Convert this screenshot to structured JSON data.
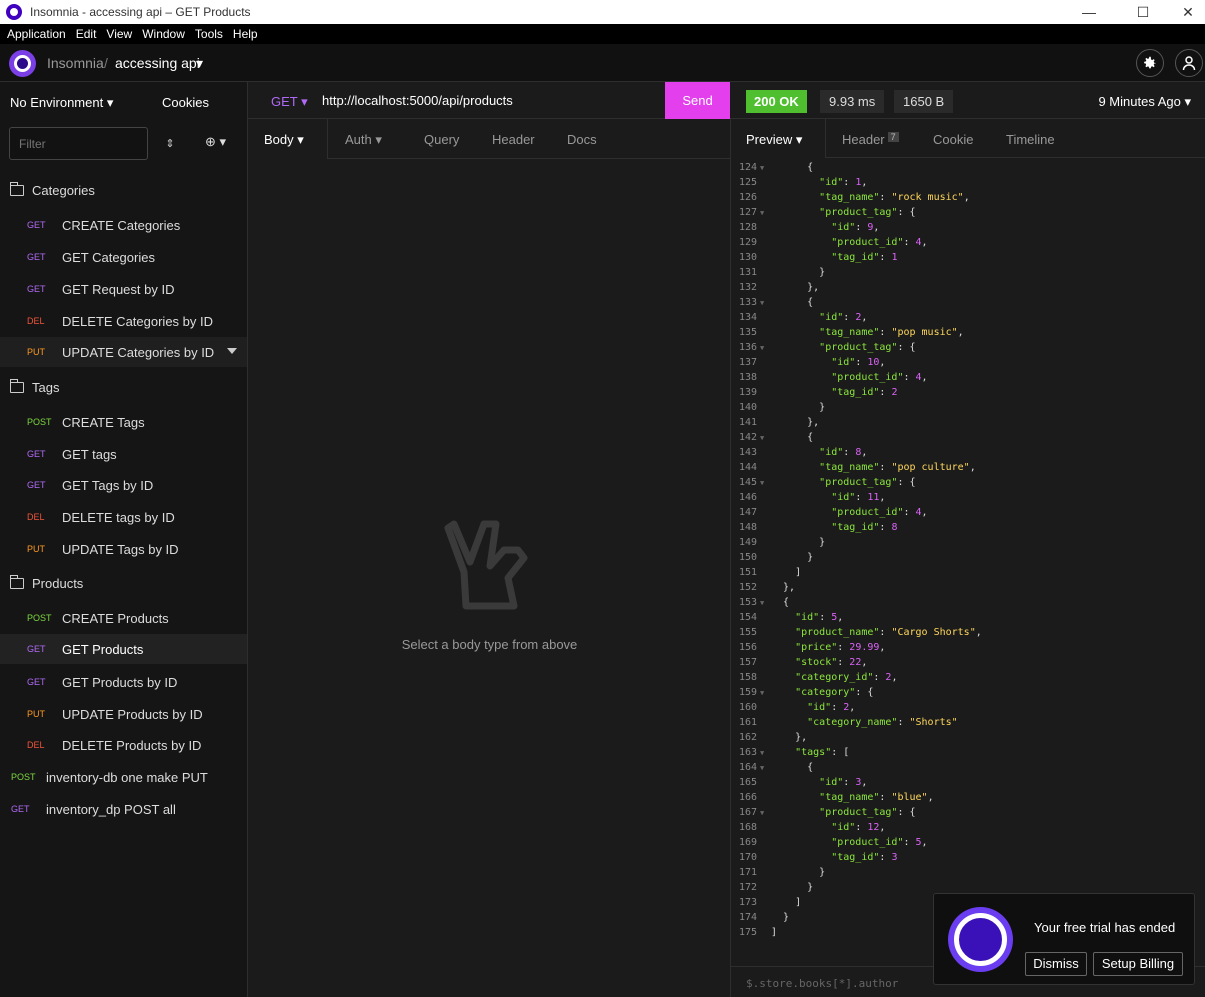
{
  "window": {
    "title": "Insomnia - accessing api – GET Products",
    "min": "—",
    "max": "☐",
    "close": "✕"
  },
  "menu": [
    "Application",
    "Edit",
    "View",
    "Window",
    "Tools",
    "Help"
  ],
  "header": {
    "app": "Insomnia",
    "sep": "/",
    "project": "accessing api",
    "caret": "▾"
  },
  "sidebar": {
    "environment": "No Environment ▾",
    "cookies": "Cookies",
    "filter_placeholder": "Filter",
    "sort_icon": "⇕",
    "add_icon": "⊕ ▾",
    "folders": [
      {
        "label": "Categories",
        "items": [
          {
            "method": "GET",
            "name": "CREATE Categories"
          },
          {
            "method": "GET",
            "name": "GET Categories"
          },
          {
            "method": "GET",
            "name": "GET Request by ID"
          },
          {
            "method": "DEL",
            "name": "DELETE Categories by ID"
          },
          {
            "method": "PUT",
            "name": "UPDATE Categories by ID"
          }
        ]
      },
      {
        "label": "Tags",
        "items": [
          {
            "method": "POST",
            "name": "CREATE Tags"
          },
          {
            "method": "GET",
            "name": "GET tags"
          },
          {
            "method": "GET",
            "name": "GET Tags by ID"
          },
          {
            "method": "DEL",
            "name": "DELETE tags by ID"
          },
          {
            "method": "PUT",
            "name": "UPDATE Tags by ID"
          }
        ]
      },
      {
        "label": "Products",
        "items": [
          {
            "method": "POST",
            "name": "CREATE Products"
          },
          {
            "method": "GET",
            "name": "GET Products"
          },
          {
            "method": "GET",
            "name": "GET Products by ID"
          },
          {
            "method": "PUT",
            "name": "UPDATE Products by ID"
          },
          {
            "method": "DEL",
            "name": "DELETE Products by ID"
          }
        ]
      }
    ],
    "root_items": [
      {
        "method": "POST",
        "name": "inventory-db one make PUT"
      },
      {
        "method": "GET",
        "name": "inventory_dp POST all"
      }
    ]
  },
  "request": {
    "method": "GET ▾",
    "url": "http://localhost:5000/api/products",
    "send": "Send",
    "tabs": [
      "Body ▾",
      "Auth ▾",
      "Query",
      "Header",
      "Docs"
    ],
    "empty_text": "Select a body type from above"
  },
  "response": {
    "status": "200 OK",
    "time": "9.93 ms",
    "size": "1650 B",
    "ago": "9 Minutes Ago ▾",
    "tabs": [
      "Preview ▾",
      "Header",
      "Cookie",
      "Timeline"
    ],
    "header_count": "7",
    "filter_placeholder": "$.store.books[*].author",
    "code": [
      {
        "n": "124",
        "f": true,
        "t": "      {"
      },
      {
        "n": "125",
        "t": "        \"id\": 1,"
      },
      {
        "n": "126",
        "t": "        \"tag_name\": \"rock music\","
      },
      {
        "n": "127",
        "f": true,
        "t": "        \"product_tag\": {"
      },
      {
        "n": "128",
        "t": "          \"id\": 9,"
      },
      {
        "n": "129",
        "t": "          \"product_id\": 4,"
      },
      {
        "n": "130",
        "t": "          \"tag_id\": 1"
      },
      {
        "n": "131",
        "t": "        }"
      },
      {
        "n": "132",
        "t": "      },"
      },
      {
        "n": "133",
        "f": true,
        "t": "      {"
      },
      {
        "n": "134",
        "t": "        \"id\": 2,"
      },
      {
        "n": "135",
        "t": "        \"tag_name\": \"pop music\","
      },
      {
        "n": "136",
        "f": true,
        "t": "        \"product_tag\": {"
      },
      {
        "n": "137",
        "t": "          \"id\": 10,"
      },
      {
        "n": "138",
        "t": "          \"product_id\": 4,"
      },
      {
        "n": "139",
        "t": "          \"tag_id\": 2"
      },
      {
        "n": "140",
        "t": "        }"
      },
      {
        "n": "141",
        "t": "      },"
      },
      {
        "n": "142",
        "f": true,
        "t": "      {"
      },
      {
        "n": "143",
        "t": "        \"id\": 8,"
      },
      {
        "n": "144",
        "t": "        \"tag_name\": \"pop culture\","
      },
      {
        "n": "145",
        "f": true,
        "t": "        \"product_tag\": {"
      },
      {
        "n": "146",
        "t": "          \"id\": 11,"
      },
      {
        "n": "147",
        "t": "          \"product_id\": 4,"
      },
      {
        "n": "148",
        "t": "          \"tag_id\": 8"
      },
      {
        "n": "149",
        "t": "        }"
      },
      {
        "n": "150",
        "t": "      }"
      },
      {
        "n": "151",
        "t": "    ]"
      },
      {
        "n": "152",
        "t": "  },"
      },
      {
        "n": "153",
        "f": true,
        "t": "  {"
      },
      {
        "n": "154",
        "t": "    \"id\": 5,"
      },
      {
        "n": "155",
        "t": "    \"product_name\": \"Cargo Shorts\","
      },
      {
        "n": "156",
        "t": "    \"price\": 29.99,"
      },
      {
        "n": "157",
        "t": "    \"stock\": 22,"
      },
      {
        "n": "158",
        "t": "    \"category_id\": 2,"
      },
      {
        "n": "159",
        "f": true,
        "t": "    \"category\": {"
      },
      {
        "n": "160",
        "t": "      \"id\": 2,"
      },
      {
        "n": "161",
        "t": "      \"category_name\": \"Shorts\""
      },
      {
        "n": "162",
        "t": "    },"
      },
      {
        "n": "163",
        "f": true,
        "t": "    \"tags\": ["
      },
      {
        "n": "164",
        "f": true,
        "t": "      {"
      },
      {
        "n": "165",
        "t": "        \"id\": 3,"
      },
      {
        "n": "166",
        "t": "        \"tag_name\": \"blue\","
      },
      {
        "n": "167",
        "f": true,
        "t": "        \"product_tag\": {"
      },
      {
        "n": "168",
        "t": "          \"id\": 12,"
      },
      {
        "n": "169",
        "t": "          \"product_id\": 5,"
      },
      {
        "n": "170",
        "t": "          \"tag_id\": 3"
      },
      {
        "n": "171",
        "t": "        }"
      },
      {
        "n": "172",
        "t": "      }"
      },
      {
        "n": "173",
        "t": "    ]"
      },
      {
        "n": "174",
        "t": "  }"
      },
      {
        "n": "175",
        "t": "]"
      }
    ]
  },
  "toast": {
    "message": "Your free trial has ended",
    "dismiss": "Dismiss",
    "setup": "Setup Billing"
  },
  "colors": {
    "send": "#e33fed",
    "status_ok": "#4fbf30",
    "get": "#b06af5",
    "del": "#f0553a",
    "put": "#ff9a1f",
    "post": "#7dd83f"
  }
}
